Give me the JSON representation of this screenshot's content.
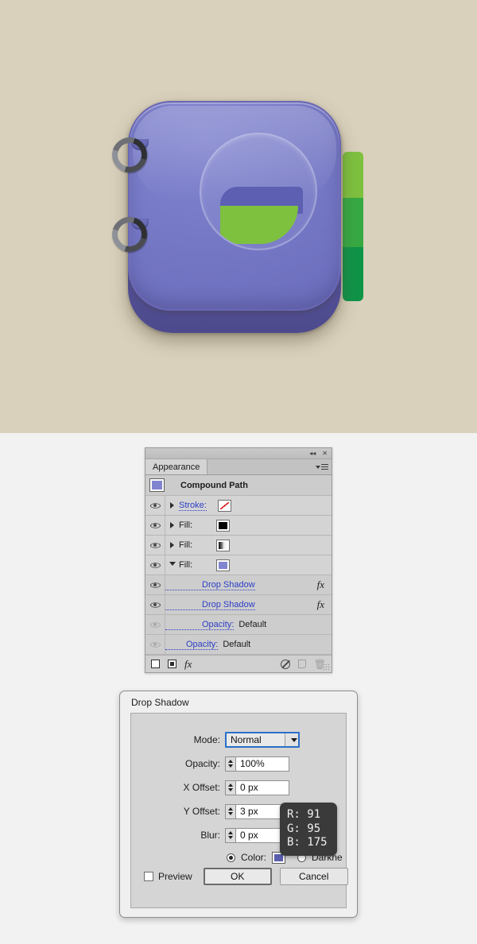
{
  "artwork": {
    "name": "notebook-app-icon",
    "description": "Purple ring-bound notebook icon with green index tabs and leaf emblem",
    "background_color": "#d9d1bc",
    "cover_color": "#7679c6",
    "spine_color": "#56529a",
    "page_edge_color": "#f08a28",
    "leaf_dark_color": "#5d5fb2",
    "leaf_green_color": "#7ec13f",
    "tabs": [
      {
        "name": "tab-light-green",
        "color": "#7ec13f"
      },
      {
        "name": "tab-medium-green",
        "color": "#36a943"
      },
      {
        "name": "tab-dark-green",
        "color": "#0f9448"
      }
    ]
  },
  "panel": {
    "title": "Appearance",
    "titlebar": {
      "collapse_icon": "◂◂",
      "close_icon": "✕"
    },
    "menu_icon": "panel-menu-icon",
    "target": {
      "label": "Compound Path",
      "swatch_color": "#8184cf"
    },
    "rows": [
      {
        "label": "Stroke:",
        "link": true,
        "visible": true,
        "expandable": true,
        "expanded": false,
        "swatch": "none",
        "fx": false
      },
      {
        "label": "Fill:",
        "link": false,
        "visible": true,
        "expandable": true,
        "expanded": false,
        "swatch": "black",
        "fx": false
      },
      {
        "label": "Fill:",
        "link": false,
        "visible": true,
        "expandable": true,
        "expanded": false,
        "swatch": "gradient",
        "fx": false
      },
      {
        "label": "Fill:",
        "link": false,
        "visible": true,
        "expandable": true,
        "expanded": true,
        "swatch": "blue",
        "fx": false
      },
      {
        "label": "Drop Shadow",
        "link": true,
        "visible": true,
        "expandable": false,
        "indent": "fx",
        "fx": true,
        "fx_label": "fx"
      },
      {
        "label": "Drop Shadow",
        "link": true,
        "visible": true,
        "expandable": false,
        "indent": "fx",
        "fx": true,
        "fx_label": "fx"
      },
      {
        "label": "Opacity:",
        "value": "Default",
        "link": true,
        "visible": false,
        "expandable": false,
        "indent": "op",
        "fx": false
      },
      {
        "label": "Opacity:",
        "value": "Default",
        "link": true,
        "visible": false,
        "expandable": false,
        "indent": "op2",
        "fx": false
      }
    ],
    "footer": {
      "add_stroke": "add-new-stroke",
      "add_fill": "add-new-fill",
      "fx_label": "fx",
      "clear": "clear-appearance",
      "duplicate": "duplicate-item",
      "delete": "delete-item"
    }
  },
  "dialog": {
    "title": "Drop Shadow",
    "fields": {
      "mode_label": "Mode:",
      "mode_value": "Normal",
      "opacity_label": "Opacity:",
      "opacity_value": "100%",
      "x_offset_label": "X Offset:",
      "x_offset_value": "0 px",
      "y_offset_label": "Y Offset:",
      "y_offset_value": "3 px",
      "blur_label": "Blur:",
      "blur_value": "0 px"
    },
    "radios": {
      "color_label": "Color:",
      "color_value": "#5b5faf",
      "darkness_label": "Darkne",
      "color_selected": true
    },
    "preview_label": "Preview",
    "ok_label": "OK",
    "cancel_label": "Cancel"
  },
  "tooltip": {
    "r": "R: 91",
    "g": "G: 95",
    "b": "B: 175"
  }
}
